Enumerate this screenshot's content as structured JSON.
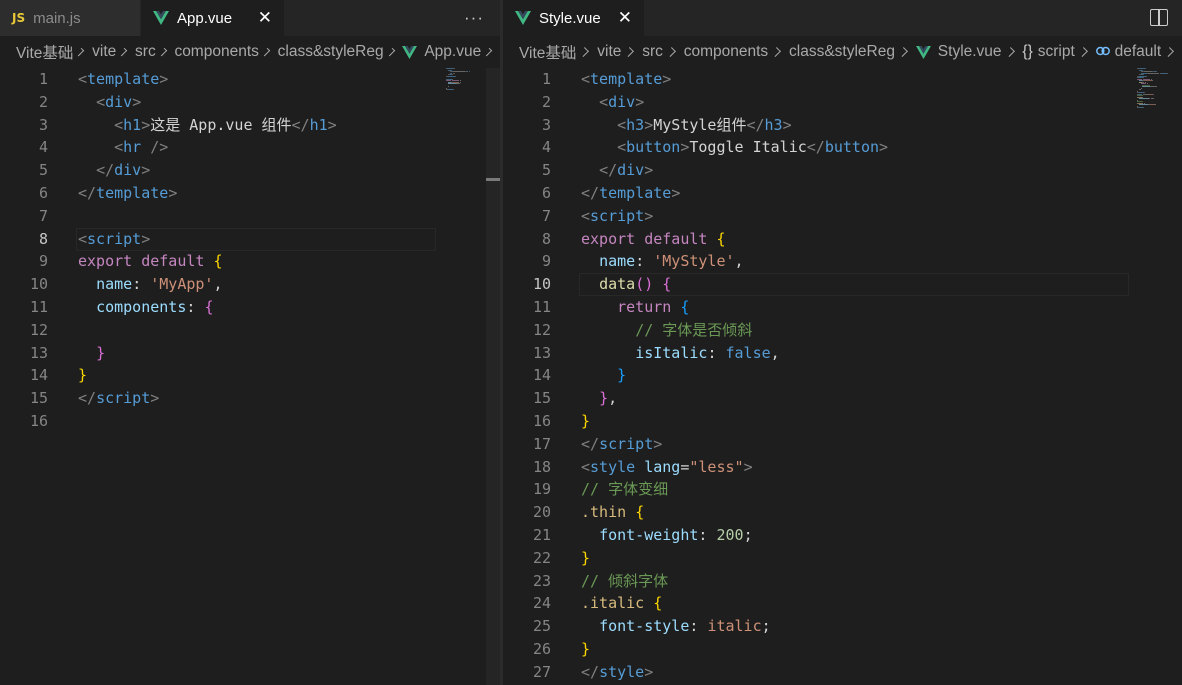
{
  "left": {
    "tabs": [
      {
        "name": "tab-main-js",
        "icon": "js-icon",
        "icon_text": "JS",
        "label": "main.js",
        "active": false
      },
      {
        "name": "tab-app-vue",
        "icon": "vue-icon",
        "label": "App.vue",
        "active": true,
        "close": "✕"
      }
    ],
    "more_actions": "···",
    "breadcrumb": [
      "Vite基础",
      "vite",
      "src",
      "components",
      "class&styleReg",
      "App.vue"
    ],
    "current_line": 8,
    "lines": [
      {
        "n": "1"
      },
      {
        "n": "2"
      },
      {
        "n": "3"
      },
      {
        "n": "4"
      },
      {
        "n": "5"
      },
      {
        "n": "6"
      },
      {
        "n": "7"
      },
      {
        "n": "8"
      },
      {
        "n": "9"
      },
      {
        "n": "10"
      },
      {
        "n": "11"
      },
      {
        "n": "12"
      },
      {
        "n": "13"
      },
      {
        "n": "14"
      },
      {
        "n": "15"
      },
      {
        "n": "16"
      }
    ],
    "code": [
      [
        [
          "t-punc",
          "<"
        ],
        [
          "t-tag",
          "template"
        ],
        [
          "t-punc",
          ">"
        ]
      ],
      [
        [
          "t-txt",
          "  "
        ],
        [
          "t-punc",
          "<"
        ],
        [
          "t-tag",
          "div"
        ],
        [
          "t-punc",
          ">"
        ]
      ],
      [
        [
          "t-txt",
          "    "
        ],
        [
          "t-punc",
          "<"
        ],
        [
          "t-tag",
          "h1"
        ],
        [
          "t-punc",
          ">"
        ],
        [
          "t-txt",
          "这是 App.vue 组件"
        ],
        [
          "t-punc",
          "</"
        ],
        [
          "t-tag",
          "h1"
        ],
        [
          "t-punc",
          ">"
        ]
      ],
      [
        [
          "t-txt",
          "    "
        ],
        [
          "t-punc",
          "<"
        ],
        [
          "t-tag",
          "hr"
        ],
        [
          "t-txt",
          " "
        ],
        [
          "t-punc",
          "/>"
        ]
      ],
      [
        [
          "t-txt",
          "  "
        ],
        [
          "t-punc",
          "</"
        ],
        [
          "t-tag",
          "div"
        ],
        [
          "t-punc",
          ">"
        ]
      ],
      [
        [
          "t-punc",
          "</"
        ],
        [
          "t-tag",
          "template"
        ],
        [
          "t-punc",
          ">"
        ]
      ],
      [],
      [
        [
          "t-punc",
          "<"
        ],
        [
          "t-tag",
          "script"
        ],
        [
          "t-punc",
          ">"
        ]
      ],
      [
        [
          "t-kw",
          "export"
        ],
        [
          "t-txt",
          " "
        ],
        [
          "t-kw",
          "default"
        ],
        [
          "t-txt",
          " "
        ],
        [
          "t-br1",
          "{"
        ]
      ],
      [
        [
          "t-txt",
          "  "
        ],
        [
          "t-key",
          "name"
        ],
        [
          "t-txt",
          ": "
        ],
        [
          "t-str",
          "'MyApp'"
        ],
        [
          "t-txt",
          ","
        ]
      ],
      [
        [
          "t-txt",
          "  "
        ],
        [
          "t-key",
          "components"
        ],
        [
          "t-txt",
          ": "
        ],
        [
          "t-br2",
          "{"
        ]
      ],
      [],
      [
        [
          "t-txt",
          "  "
        ],
        [
          "t-br2",
          "}"
        ]
      ],
      [
        [
          "t-br1",
          "}"
        ]
      ],
      [
        [
          "t-punc",
          "</"
        ],
        [
          "t-tag",
          "script"
        ],
        [
          "t-punc",
          ">"
        ]
      ],
      []
    ]
  },
  "right": {
    "tabs": [
      {
        "name": "tab-style-vue",
        "icon": "vue-icon",
        "label": "Style.vue",
        "active": true,
        "close": "✕"
      }
    ],
    "breadcrumb": [
      "Vite基础",
      "vite",
      "src",
      "components",
      "class&styleReg",
      "Style.vue",
      "script",
      "default"
    ],
    "breadcrumb_braces": "{}",
    "current_line": 10,
    "lines": [
      {
        "n": "1"
      },
      {
        "n": "2"
      },
      {
        "n": "3"
      },
      {
        "n": "4"
      },
      {
        "n": "5"
      },
      {
        "n": "6"
      },
      {
        "n": "7"
      },
      {
        "n": "8"
      },
      {
        "n": "9"
      },
      {
        "n": "10"
      },
      {
        "n": "11"
      },
      {
        "n": "12"
      },
      {
        "n": "13"
      },
      {
        "n": "14"
      },
      {
        "n": "15"
      },
      {
        "n": "16"
      },
      {
        "n": "17"
      },
      {
        "n": "18"
      },
      {
        "n": "19"
      },
      {
        "n": "20"
      },
      {
        "n": "21"
      },
      {
        "n": "22"
      },
      {
        "n": "23"
      },
      {
        "n": "24"
      },
      {
        "n": "25"
      },
      {
        "n": "26"
      },
      {
        "n": "27"
      }
    ],
    "code": [
      [
        [
          "t-punc",
          "<"
        ],
        [
          "t-tag",
          "template"
        ],
        [
          "t-punc",
          ">"
        ]
      ],
      [
        [
          "t-txt",
          "  "
        ],
        [
          "t-punc",
          "<"
        ],
        [
          "t-tag",
          "div"
        ],
        [
          "t-punc",
          ">"
        ]
      ],
      [
        [
          "t-txt",
          "    "
        ],
        [
          "t-punc",
          "<"
        ],
        [
          "t-tag",
          "h3"
        ],
        [
          "t-punc",
          ">"
        ],
        [
          "t-txt",
          "MyStyle组件"
        ],
        [
          "t-punc",
          "</"
        ],
        [
          "t-tag",
          "h3"
        ],
        [
          "t-punc",
          ">"
        ]
      ],
      [
        [
          "t-txt",
          "    "
        ],
        [
          "t-punc",
          "<"
        ],
        [
          "t-tag",
          "button"
        ],
        [
          "t-punc",
          ">"
        ],
        [
          "t-txt",
          "Toggle Italic"
        ],
        [
          "t-punc",
          "</"
        ],
        [
          "t-tag",
          "button"
        ],
        [
          "t-punc",
          ">"
        ]
      ],
      [
        [
          "t-txt",
          "  "
        ],
        [
          "t-punc",
          "</"
        ],
        [
          "t-tag",
          "div"
        ],
        [
          "t-punc",
          ">"
        ]
      ],
      [
        [
          "t-punc",
          "</"
        ],
        [
          "t-tag",
          "template"
        ],
        [
          "t-punc",
          ">"
        ]
      ],
      [
        [
          "t-punc",
          "<"
        ],
        [
          "t-tag",
          "script"
        ],
        [
          "t-punc",
          ">"
        ]
      ],
      [
        [
          "t-kw",
          "export"
        ],
        [
          "t-txt",
          " "
        ],
        [
          "t-kw",
          "default"
        ],
        [
          "t-txt",
          " "
        ],
        [
          "t-br1",
          "{"
        ]
      ],
      [
        [
          "t-txt",
          "  "
        ],
        [
          "t-key",
          "name"
        ],
        [
          "t-txt",
          ": "
        ],
        [
          "t-str",
          "'MyStyle'"
        ],
        [
          "t-txt",
          ","
        ]
      ],
      [
        [
          "t-txt",
          "  "
        ],
        [
          "t-fn",
          "data"
        ],
        [
          "t-br2",
          "()"
        ],
        [
          "t-txt",
          " "
        ],
        [
          "t-br2",
          "{"
        ]
      ],
      [
        [
          "t-txt",
          "    "
        ],
        [
          "t-kw",
          "return"
        ],
        [
          "t-txt",
          " "
        ],
        [
          "t-br3",
          "{"
        ]
      ],
      [
        [
          "t-txt",
          "      "
        ],
        [
          "t-cmt",
          "// 字体是否倾斜"
        ]
      ],
      [
        [
          "t-txt",
          "      "
        ],
        [
          "t-key",
          "isItalic"
        ],
        [
          "t-txt",
          ": "
        ],
        [
          "t-bool",
          "false"
        ],
        [
          "t-txt",
          ","
        ]
      ],
      [
        [
          "t-txt",
          "    "
        ],
        [
          "t-br3",
          "}"
        ]
      ],
      [
        [
          "t-txt",
          "  "
        ],
        [
          "t-br2",
          "}"
        ],
        [
          "t-txt",
          ","
        ]
      ],
      [
        [
          "t-br1",
          "}"
        ]
      ],
      [
        [
          "t-punc",
          "</"
        ],
        [
          "t-tag",
          "script"
        ],
        [
          "t-punc",
          ">"
        ]
      ],
      [
        [
          "t-punc",
          "<"
        ],
        [
          "t-tag",
          "style"
        ],
        [
          "t-txt",
          " "
        ],
        [
          "t-attr",
          "lang"
        ],
        [
          "t-txt",
          "="
        ],
        [
          "t-str",
          "\"less\""
        ],
        [
          "t-punc",
          ">"
        ]
      ],
      [
        [
          "t-cmt",
          "// 字体变细"
        ]
      ],
      [
        [
          "t-sel",
          ".thin"
        ],
        [
          "t-txt",
          " "
        ],
        [
          "t-br1",
          "{"
        ]
      ],
      [
        [
          "t-txt",
          "  "
        ],
        [
          "t-key",
          "font-weight"
        ],
        [
          "t-txt",
          ": "
        ],
        [
          "t-num",
          "200"
        ],
        [
          "t-txt",
          ";"
        ]
      ],
      [
        [
          "t-br1",
          "}"
        ]
      ],
      [
        [
          "t-cmt",
          "// 倾斜字体"
        ]
      ],
      [
        [
          "t-sel",
          ".italic"
        ],
        [
          "t-txt",
          " "
        ],
        [
          "t-br1",
          "{"
        ]
      ],
      [
        [
          "t-txt",
          "  "
        ],
        [
          "t-key",
          "font-style"
        ],
        [
          "t-txt",
          ": "
        ],
        [
          "t-str",
          "italic"
        ],
        [
          "t-txt",
          ";"
        ]
      ],
      [
        [
          "t-br1",
          "}"
        ]
      ],
      [
        [
          "t-punc",
          "</"
        ],
        [
          "t-tag",
          "style"
        ],
        [
          "t-punc",
          ">"
        ]
      ]
    ]
  }
}
